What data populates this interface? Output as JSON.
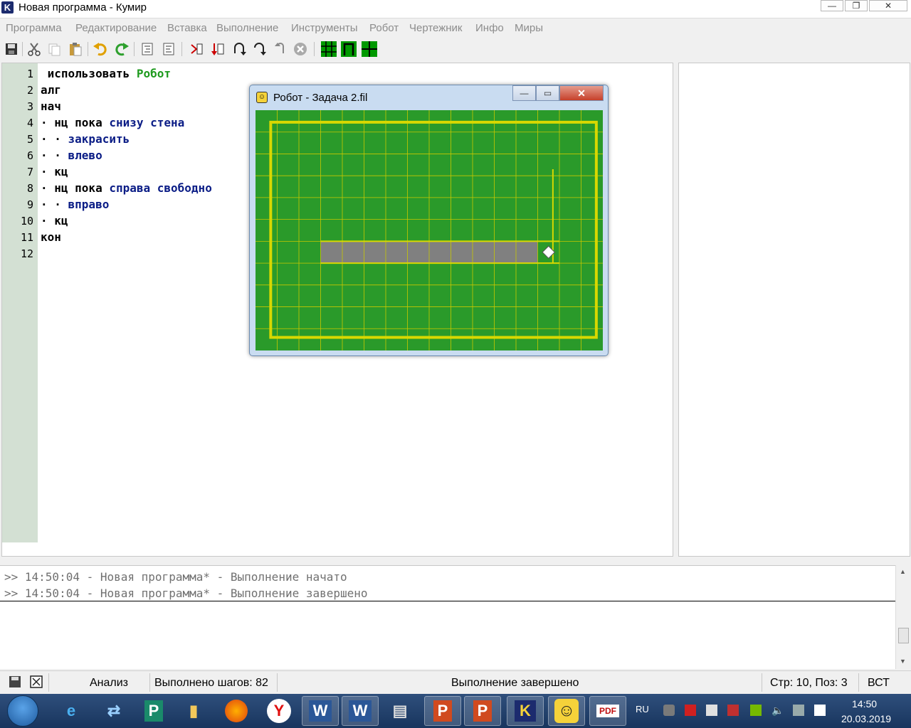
{
  "window": {
    "title": "Новая программа - Кумир",
    "icon_letter": "K"
  },
  "menu": [
    "Программа",
    "Редактирование",
    "Вставка",
    "Выполнение",
    "Инструменты",
    "Робот",
    "Чертежник",
    "Инфо",
    "Миры"
  ],
  "editor": {
    "line_numbers": [
      "1",
      "2",
      "3",
      "4",
      "5",
      "6",
      "7",
      "8",
      "9",
      "10",
      "11",
      "12"
    ],
    "lines": [
      {
        "plain": " использовать ",
        "green": "Робот",
        "blue": ""
      },
      {
        "plain": "алг",
        "green": "",
        "blue": ""
      },
      {
        "plain": "нач",
        "green": "",
        "blue": ""
      },
      {
        "plain": "· нц пока ",
        "green": "",
        "blue": "снизу стена"
      },
      {
        "plain": "· · ",
        "green": "",
        "blue": "закрасить"
      },
      {
        "plain": "· · ",
        "green": "",
        "blue": "влево"
      },
      {
        "plain": "· кц",
        "green": "",
        "blue": ""
      },
      {
        "plain": "· нц пока ",
        "green": "",
        "blue": "справа свободно"
      },
      {
        "plain": "· · ",
        "green": "",
        "blue": "вправо"
      },
      {
        "plain": "· кц",
        "green": "",
        "blue": ""
      },
      {
        "plain": "кон",
        "green": "",
        "blue": ""
      },
      {
        "plain": "",
        "green": "",
        "blue": ""
      }
    ]
  },
  "robot_window": {
    "title": "Робот - Задача 2.fil",
    "field_color": "#2a9a2a",
    "wall_color": "#d8d800",
    "painted_color": "#808080",
    "columns": 16,
    "rows": 11,
    "painted_cells": [
      [
        3,
        6
      ],
      [
        4,
        6
      ],
      [
        5,
        6
      ],
      [
        6,
        6
      ],
      [
        7,
        6
      ],
      [
        8,
        6
      ],
      [
        9,
        6
      ],
      [
        10,
        6
      ],
      [
        11,
        6
      ],
      [
        12,
        6
      ]
    ],
    "robot_cell": [
      13,
      6
    ]
  },
  "console": {
    "lines": [
      ">> 14:50:04 - Новая программа* - Выполнение начато",
      ">> 14:50:04 - Новая программа* - Выполнение завершено"
    ]
  },
  "status": {
    "mode": "Анализ",
    "steps": "Выполнено шагов: 82",
    "message": "Выполнение завершено",
    "position": "Стр: 10, Поз: 3",
    "insert_mode": "ВСТ"
  },
  "taskbar": {
    "apps": [
      "internet-explorer",
      "network",
      "publisher",
      "file-explorer",
      "firefox",
      "yandex",
      "word",
      "word",
      "printer",
      "powerpoint",
      "powerpoint",
      "kumir",
      "robot",
      "pdf"
    ],
    "language": "RU",
    "time": "14:50",
    "date": "20.03.2019"
  }
}
